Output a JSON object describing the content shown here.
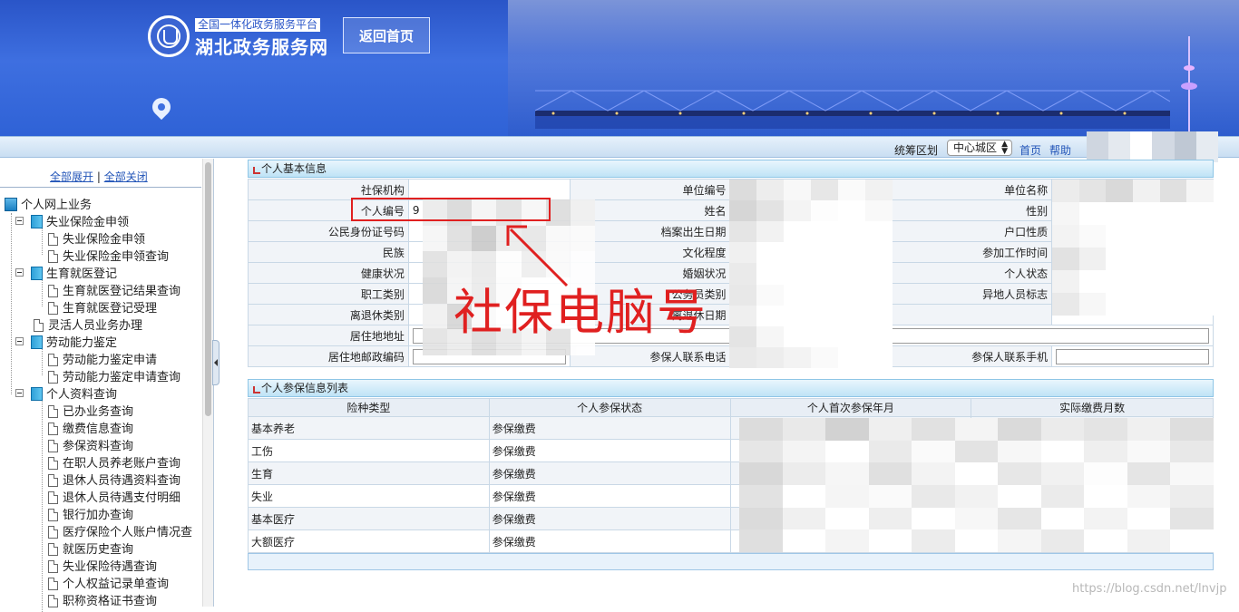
{
  "header": {
    "platform_subtitle": "全国一体化政务服务平台",
    "site_title": "湖北政务服务网",
    "home_button": "返回首页"
  },
  "toolbar": {
    "region_label": "统筹区划",
    "region_value": "中心城区",
    "home_link": "首页",
    "help_link": "帮助"
  },
  "sidebar": {
    "expand_all": "全部展开",
    "separator": "|",
    "collapse_all": "全部关闭",
    "root": "个人网上业务",
    "groups": [
      {
        "label": "失业保险金申领",
        "items": [
          "失业保险金申领",
          "失业保险金申领查询"
        ]
      },
      {
        "label": "生育就医登记",
        "items": [
          "生育就医登记结果查询",
          "生育就医登记受理"
        ]
      },
      {
        "label": "灵活人员业务办理",
        "items": []
      },
      {
        "label": "劳动能力鉴定",
        "items": [
          "劳动能力鉴定申请",
          "劳动能力鉴定申请查询"
        ]
      },
      {
        "label": "个人资料查询",
        "items": [
          "已办业务查询",
          "缴费信息查询",
          "参保资料查询",
          "在职人员养老账户查询",
          "退休人员待遇资料查询",
          "退休人员待遇支付明细",
          "银行加办查询",
          "医疗保险个人账户情况查",
          "就医历史查询",
          "失业保险待遇查询",
          "个人权益记录单查询",
          "职称资格证书查询"
        ]
      }
    ]
  },
  "basic_info": {
    "title": "个人基本信息",
    "labels": {
      "agency": "社保机构",
      "person_no": "个人编号",
      "id_no": "公民身份证号码",
      "ethnicity": "民族",
      "health": "健康状况",
      "worker_type": "职工类别",
      "retire_type": "离退休类别",
      "address": "居住地地址",
      "postcode": "居住地邮政编码",
      "unit_no": "单位编号",
      "name": "姓名",
      "archive_birth": "档案出生日期",
      "education": "文化程度",
      "marital": "婚姻状况",
      "civil_servant": "公务员类别",
      "retire_date": "离退休日期",
      "contact_phone": "参保人联系电话",
      "unit_name": "单位名称",
      "gender": "性别",
      "hukou": "户口性质",
      "work_start": "参加工作时间",
      "personal_status": "个人状态",
      "nonlocal_flag": "异地人员标志",
      "contact_mobile": "参保人联系手机"
    },
    "person_no_partial": "9"
  },
  "annotation": {
    "text": "社保电脑号"
  },
  "insurance_list": {
    "title": "个人参保信息列表",
    "columns": [
      "险种类型",
      "个人参保状态",
      "个人首次参保年月",
      "实际缴费月数"
    ],
    "rows": [
      {
        "type": "基本养老",
        "status": "参保缴费"
      },
      {
        "type": "工伤",
        "status": "参保缴费"
      },
      {
        "type": "生育",
        "status": "参保缴费"
      },
      {
        "type": "失业",
        "status": "参保缴费"
      },
      {
        "type": "基本医疗",
        "status": "参保缴费"
      },
      {
        "type": "大额医疗",
        "status": "参保缴费"
      }
    ]
  },
  "watermark": "https://blog.csdn.net/lnvjp"
}
